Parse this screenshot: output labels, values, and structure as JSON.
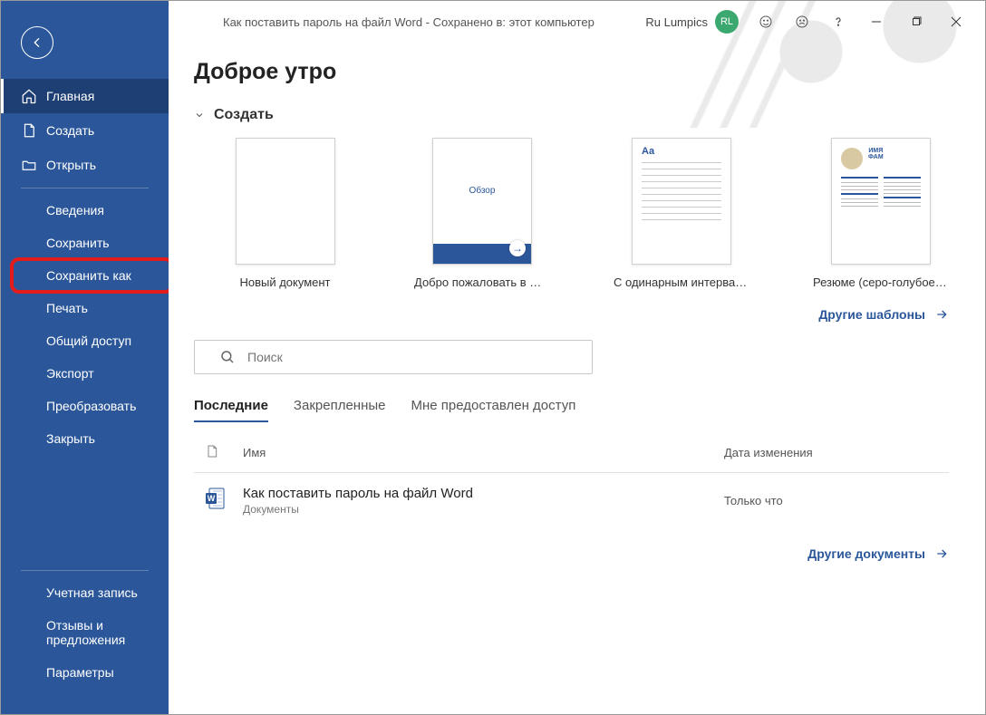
{
  "titlebar": {
    "doc_title": "Как поставить пароль на файл Word  -  Сохранено в: этот компьютер",
    "user_name": "Ru Lumpics",
    "avatar_initials": "RL"
  },
  "sidebar": {
    "back": "Назад",
    "home": "Главная",
    "new": "Создать",
    "open": "Открыть",
    "info": "Сведения",
    "save": "Сохранить",
    "save_as": "Сохранить как",
    "print": "Печать",
    "share": "Общий доступ",
    "export": "Экспорт",
    "transform": "Преобразовать",
    "close": "Закрыть",
    "account": "Учетная запись",
    "feedback": "Отзывы и предложения",
    "options": "Параметры"
  },
  "greeting": "Доброе утро",
  "create": {
    "header": "Создать",
    "templates": [
      {
        "label": "Новый документ"
      },
      {
        "label": "Добро пожаловать в Word",
        "badge": "Обзор"
      },
      {
        "label": "С одинарным интервало...",
        "aa": "Aa"
      },
      {
        "label": "Резюме (серо-голубое о..."
      }
    ],
    "more": "Другие шаблоны"
  },
  "search": {
    "placeholder": "Поиск"
  },
  "tabs": {
    "recent": "Последние",
    "pinned": "Закрепленные",
    "shared": "Мне предоставлен доступ"
  },
  "list": {
    "col_name": "Имя",
    "col_date": "Дата изменения",
    "rows": [
      {
        "name": "Как поставить пароль на файл Word",
        "location": "Документы",
        "date": "Только что"
      }
    ],
    "more": "Другие документы"
  }
}
